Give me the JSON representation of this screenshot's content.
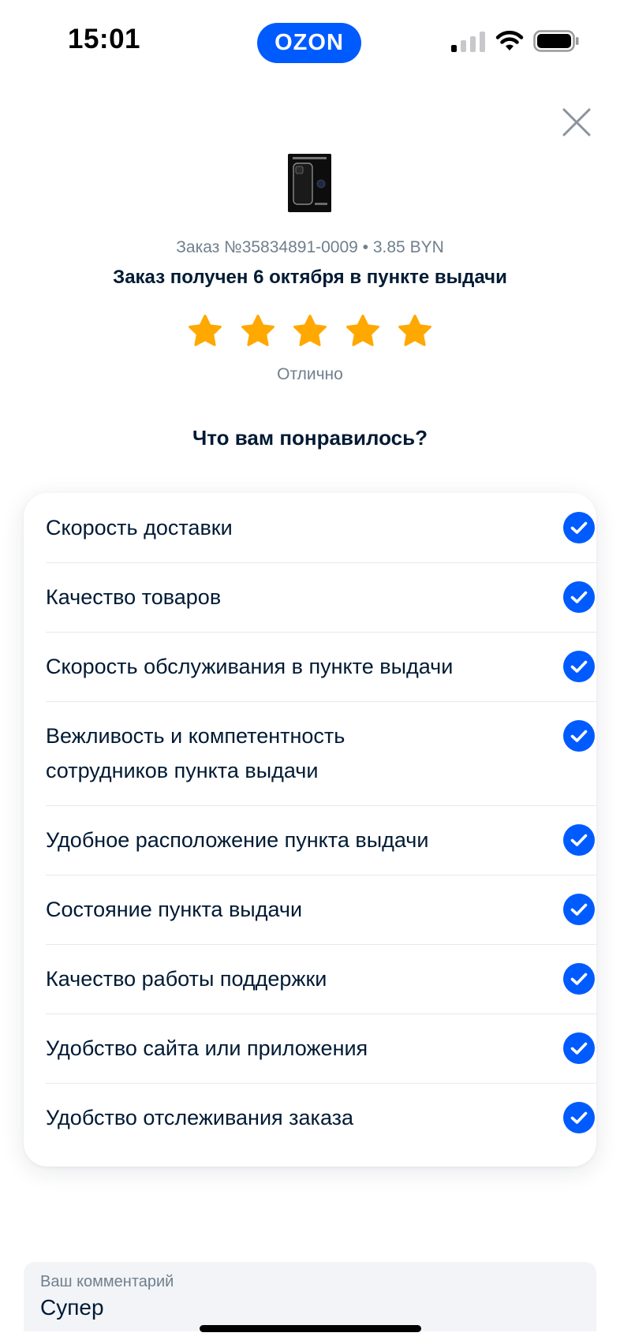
{
  "status_bar": {
    "time": "15:01",
    "brand": "OZON",
    "icons": [
      "signal-icon",
      "wifi-icon",
      "battery-icon"
    ]
  },
  "header": {
    "close_icon": "close-icon"
  },
  "order": {
    "meta": "Заказ №35834891-0009 • 3.85 BYN",
    "status": "Заказ получен 6 октября в пункте выдачи"
  },
  "rating": {
    "value": 5,
    "max": 5,
    "label": "Отлично",
    "star_color": "#ffa800"
  },
  "liked": {
    "title": "Что вам понравилось?",
    "options": [
      {
        "label": "Скорость доставки",
        "checked": true
      },
      {
        "label": "Качество товаров",
        "checked": true
      },
      {
        "label": "Скорость обслуживания в пункте выдачи",
        "checked": true
      },
      {
        "label": "Вежливость и компетентность сотрудников пункта выдачи",
        "checked": true
      },
      {
        "label": "Удобное расположение пункта выдачи",
        "checked": true
      },
      {
        "label": "Состояние пункта выдачи",
        "checked": true
      },
      {
        "label": "Качество работы поддержки",
        "checked": true
      },
      {
        "label": "Удобство сайта или приложения",
        "checked": true
      },
      {
        "label": "Удобство отслеживания заказа",
        "checked": true
      }
    ]
  },
  "comment": {
    "label": "Ваш комментарий",
    "value": "Супер"
  },
  "colors": {
    "accent": "#005bff",
    "text": "#001a34",
    "secondary_text": "#707f8d"
  }
}
